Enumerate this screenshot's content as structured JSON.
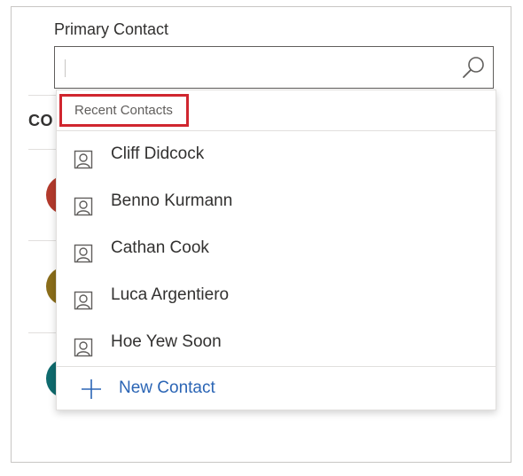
{
  "field": {
    "label": "Primary Contact",
    "value": "",
    "search_icon": "search-icon"
  },
  "background": {
    "heading_fragment": "CO",
    "avatar_colors": [
      "#b33a2c",
      "#8a6d1a",
      "#0f6b6e"
    ]
  },
  "dropdown": {
    "header": "Recent Contacts",
    "contacts": [
      {
        "name": "Cliff Didcock",
        "icon": "contact-icon"
      },
      {
        "name": "Benno Kurmann",
        "icon": "contact-icon"
      },
      {
        "name": "Cathan Cook",
        "icon": "contact-icon"
      },
      {
        "name": "Luca Argentiero",
        "icon": "contact-icon"
      },
      {
        "name": "Hoe Yew Soon",
        "icon": "contact-icon"
      }
    ],
    "new_contact_label": "New Contact",
    "new_contact_icon": "plus-icon"
  },
  "colors": {
    "highlight_border": "#d0262f",
    "link_blue": "#2b65b5"
  }
}
